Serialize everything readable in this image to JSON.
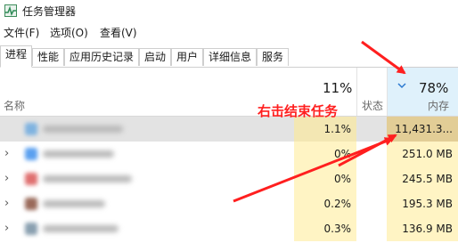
{
  "window": {
    "title": "任务管理器"
  },
  "menu": [
    "文件(F)",
    "选项(O)",
    "查看(V)"
  ],
  "tabs": [
    "进程",
    "性能",
    "应用历史记录",
    "启动",
    "用户",
    "详细信息",
    "服务"
  ],
  "active_tab": "进程",
  "columns": {
    "name": "名称",
    "cpu_percent": "11%",
    "status": "状态",
    "memory_percent": "78%",
    "memory": "内存",
    "sort_indicator": "chevron-down-icon"
  },
  "rows": [
    {
      "cpu": "1.1%",
      "memory": "11,431.3...",
      "selected": true,
      "icon_color": "#7fb3e0"
    },
    {
      "cpu": "0%",
      "memory": "251.0 MB",
      "expandable": true,
      "icon_color": "#5aa0f0"
    },
    {
      "cpu": "0%",
      "memory": "245.5 MB",
      "expandable": true,
      "icon_color": "#e07070"
    },
    {
      "cpu": "0.2%",
      "memory": "195.3 MB",
      "expandable": true,
      "icon_color": "#9a6a5a"
    },
    {
      "cpu": "0.3%",
      "memory": "136.9 MB",
      "expandable": true,
      "icon_color": "#8aa0b0"
    }
  ],
  "annotation": {
    "text": "右击结束任务",
    "color": "#ff1f1f"
  },
  "colors": {
    "accent": "#2b79d0",
    "memory_header": "#dff1fb",
    "heat_light": "#fff4c4",
    "heat_dark": "#e2cd96"
  }
}
